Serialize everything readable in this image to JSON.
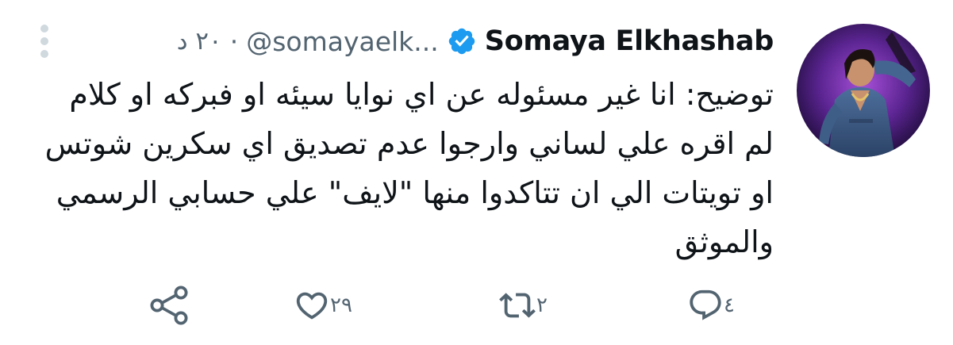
{
  "tweet": {
    "display_name": "Somaya Elkhashab",
    "handle": "@somayaelk...",
    "separator": "·",
    "time": "٢٠ د",
    "text": "توضيح: انا غير مسئوله عن اي نوايا سيئه او فبركه او كلام\nلم اقره علي لساني وارجوا عدم تصديق اي سكرين شوتس\nاو تويتات الي ان تتاكدوا منها \"لايف\" علي حسابي الرسمي\nوالموثق"
  },
  "actions": {
    "reply_count": "٤",
    "retweet_count": "٢",
    "like_count": "٢٩"
  },
  "icons": {
    "verified": "verified-badge-icon",
    "more": "more-vertical-icon",
    "reply": "reply-icon",
    "retweet": "retweet-icon",
    "like": "heart-icon",
    "share": "share-icon"
  },
  "colors": {
    "verified_blue": "#1d9bf0",
    "secondary_text": "#536471",
    "primary_text": "#0f1419"
  }
}
